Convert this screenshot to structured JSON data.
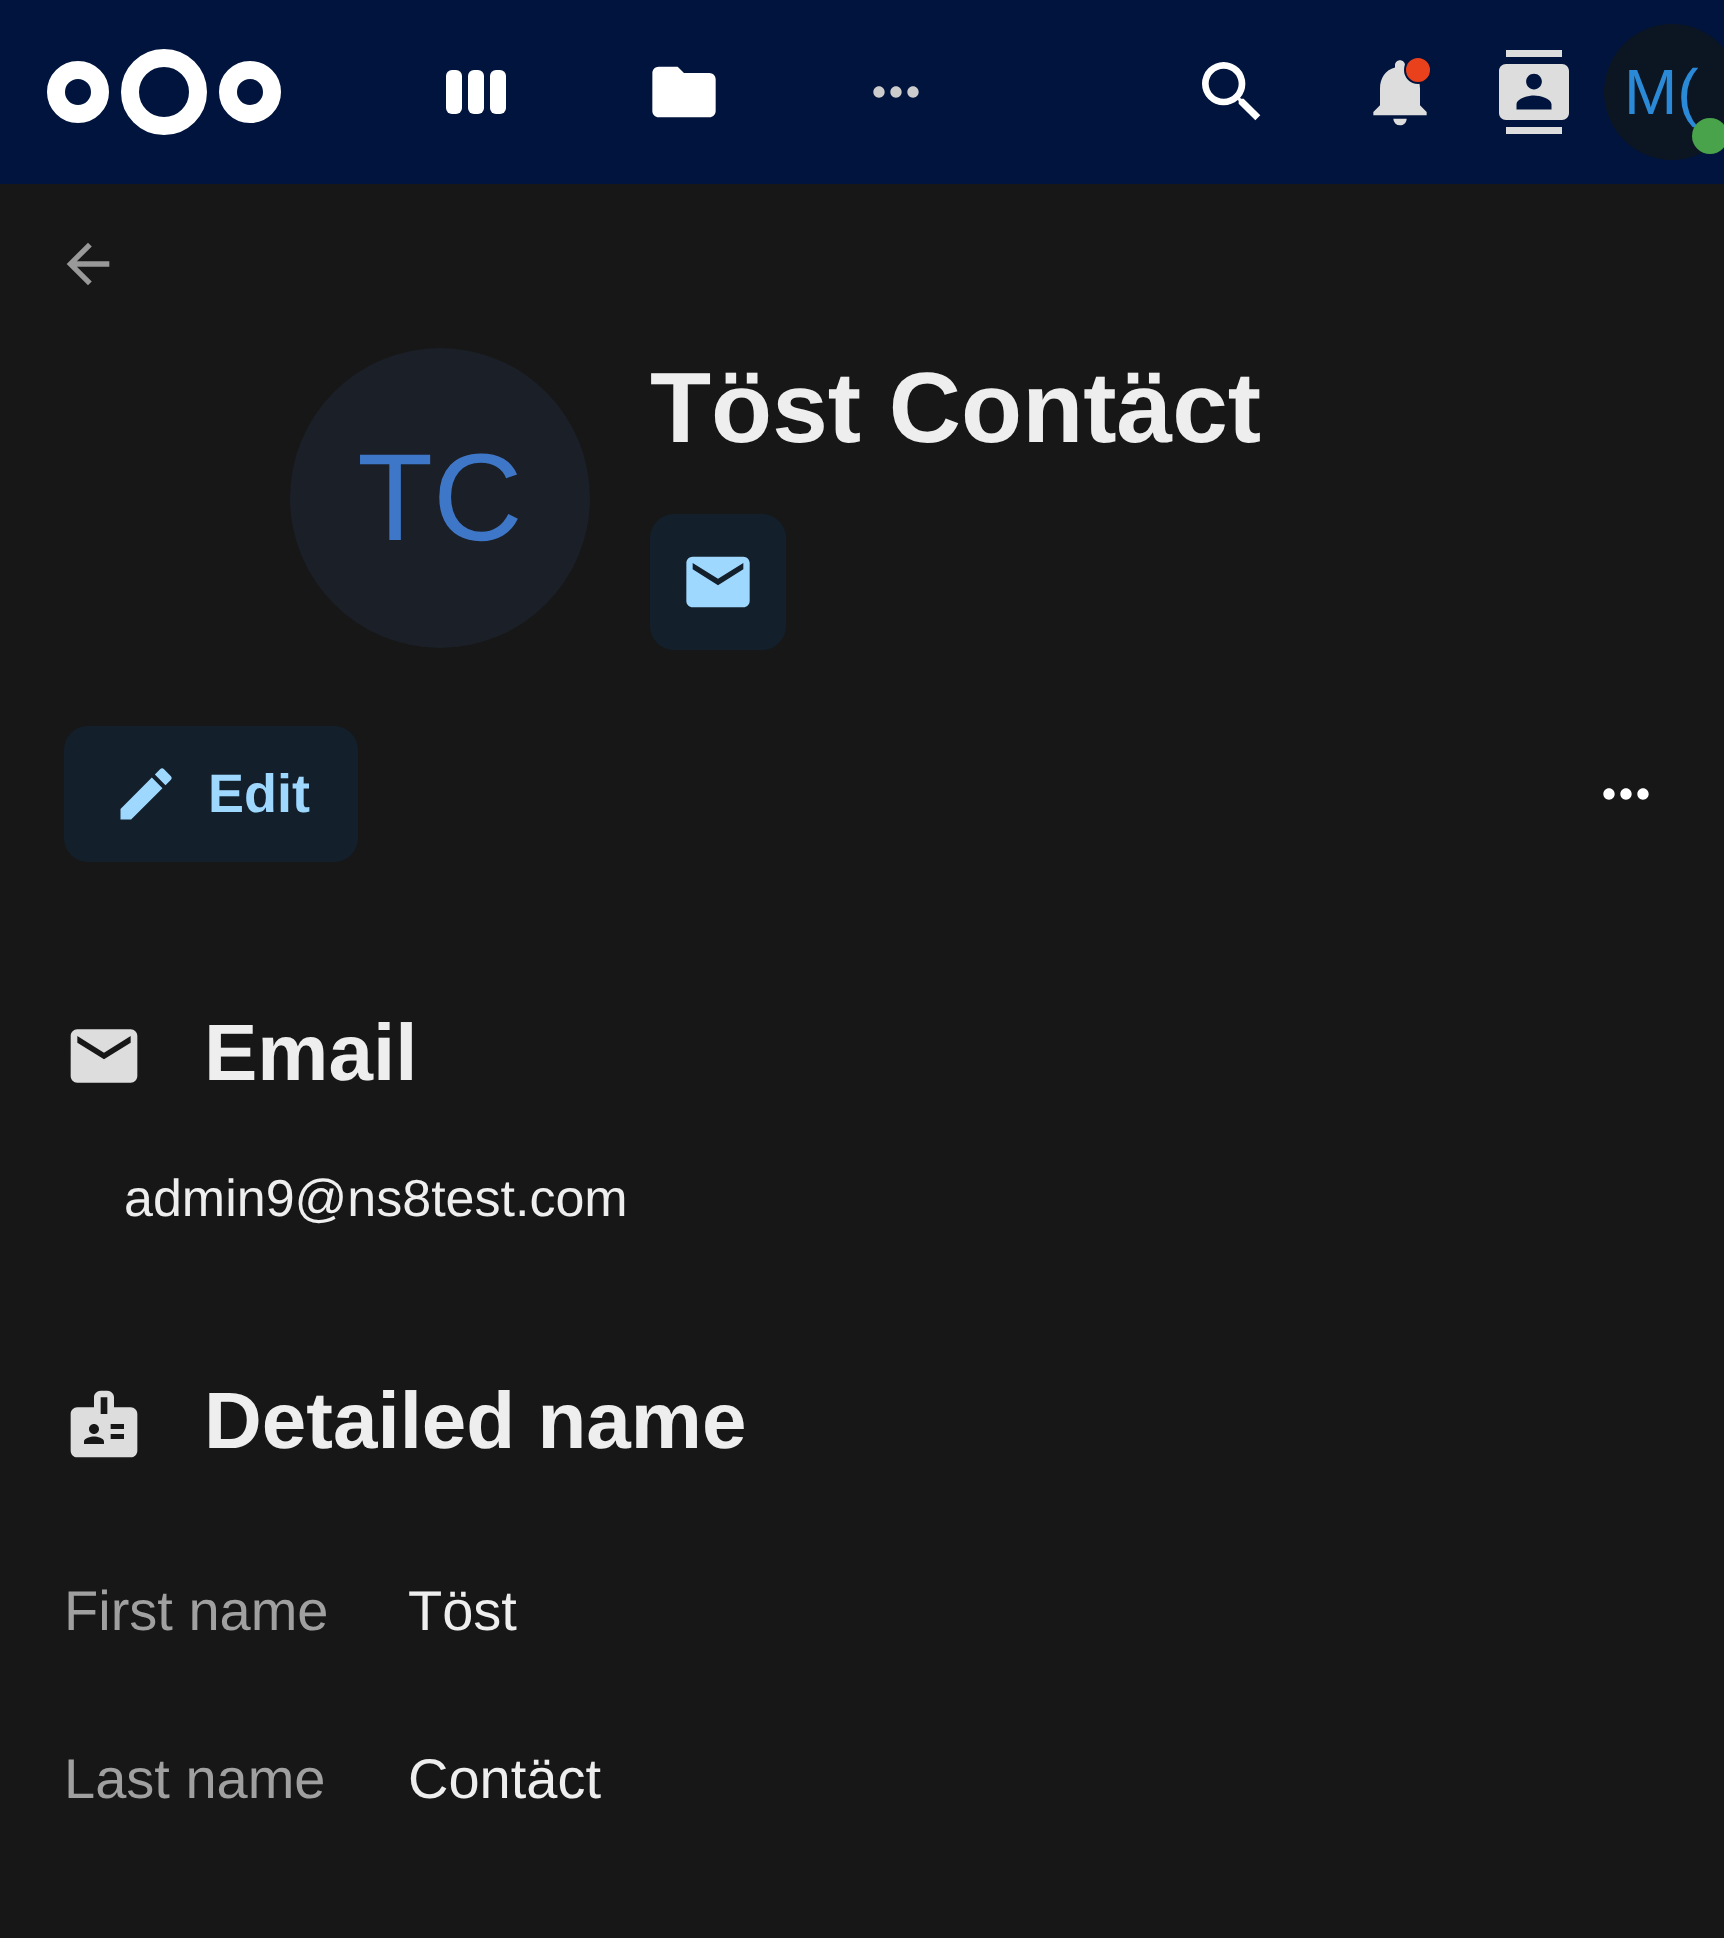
{
  "header": {
    "notifications": {
      "has_unread": true
    },
    "user": {
      "avatar_text": "M(",
      "online": true
    }
  },
  "contact": {
    "initials": "TC",
    "name": "Töst Contäct",
    "edit_label": "Edit"
  },
  "sections": [
    {
      "kind": "email",
      "title": "Email",
      "value": "admin9@ns8test.com"
    },
    {
      "kind": "name",
      "title": "Detailed name",
      "fields": [
        {
          "label": "First name",
          "value": "Töst"
        },
        {
          "label": "Last name",
          "value": "Contäct"
        }
      ]
    }
  ]
}
